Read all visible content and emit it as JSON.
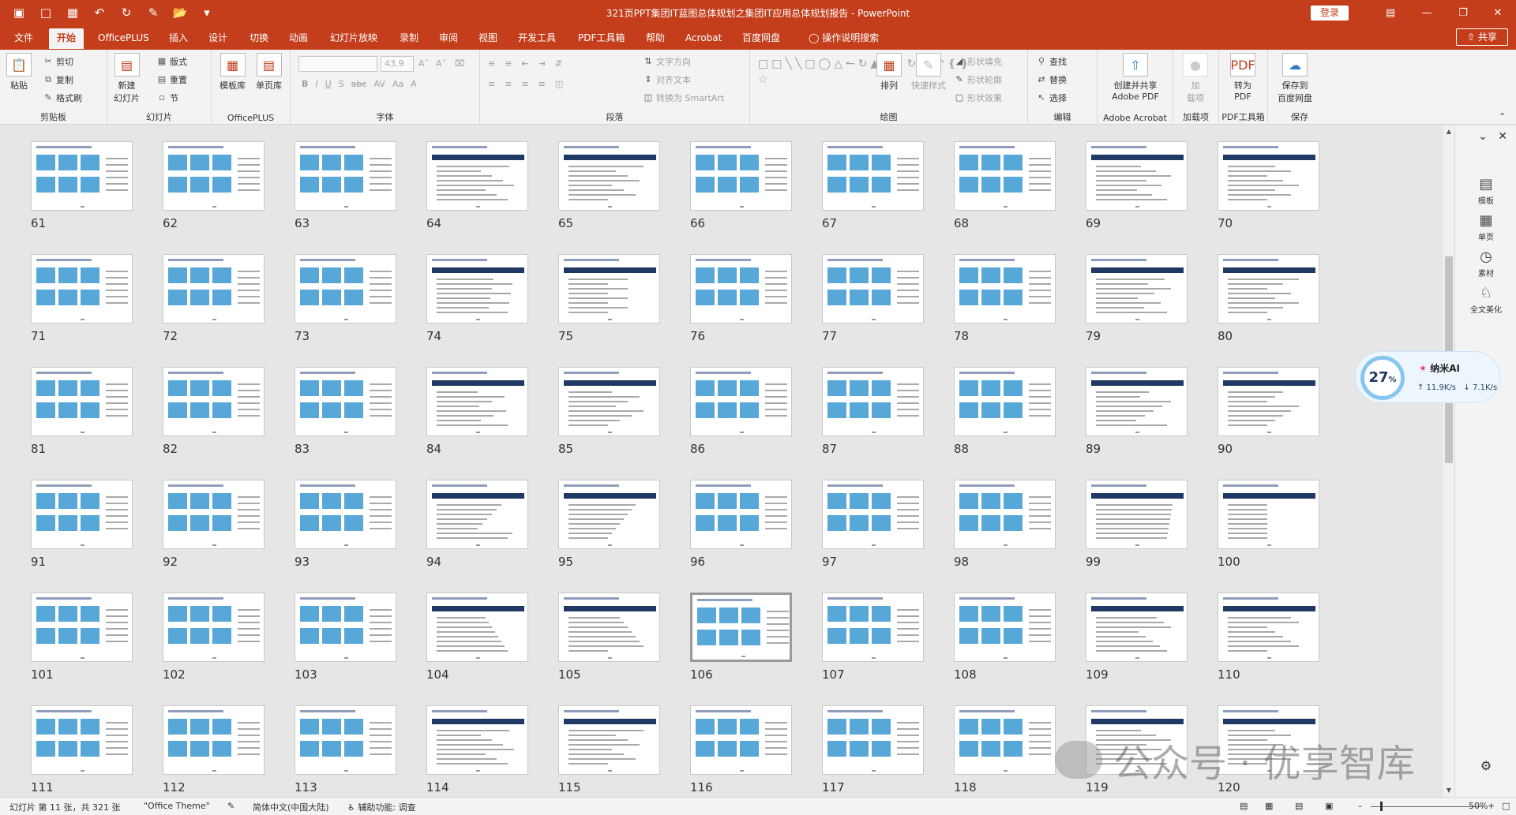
{
  "window": {
    "title": "321页PPT集团IT蓝图总体规划之集团IT应用总体规划报告  -  PowerPoint",
    "login": "登录",
    "quick_access": [
      "save-icon",
      "new-icon",
      "print-preview-icon",
      "undo-icon",
      "redo-icon",
      "format-icon",
      "open-icon",
      "customize-icon"
    ]
  },
  "tabs": [
    "文件",
    "开始",
    "OfficePLUS",
    "插入",
    "设计",
    "切换",
    "动画",
    "幻灯片放映",
    "录制",
    "审阅",
    "视图",
    "开发工具",
    "PDF工具箱",
    "帮助",
    "Acrobat",
    "百度网盘",
    "操作说明搜索"
  ],
  "active_tab": "开始",
  "share_label": "共享",
  "ribbon": {
    "clipboard": {
      "paste": "粘贴",
      "cut": "剪切",
      "copy": "复制",
      "format_painter": "格式刷",
      "label": "剪贴板"
    },
    "slides": {
      "new_slide": "新建\n幻灯片",
      "layout": "版式",
      "reset": "重置",
      "section": "节",
      "label": "幻灯片"
    },
    "officeplus": {
      "template": "模板库",
      "single": "单页库",
      "label": "OfficePLUS"
    },
    "font": {
      "font_size": "43.9",
      "label": "字体"
    },
    "paragraph": {
      "text_direction": "文字方向",
      "align_text": "对齐文本",
      "smartart": "转换为 SmartArt",
      "label": "段落"
    },
    "drawing": {
      "arrange": "排列",
      "quick_styles": "快速样式",
      "shape_fill": "形状填充",
      "shape_outline": "形状轮廓",
      "shape_effects": "形状效果",
      "label": "绘图"
    },
    "editing": {
      "find": "查找",
      "replace": "替换",
      "select": "选择",
      "label": "编辑"
    },
    "acrobat": {
      "create_share": "创建并共享\nAdobe PDF",
      "label": "Adobe Acrobat"
    },
    "addins": {
      "add": "加\n载项",
      "label": "加载项"
    },
    "pdf": {
      "convert": "转为\nPDF",
      "label": "PDF工具箱"
    },
    "save": {
      "save_baidu": "保存到\n百度网盘",
      "label": "保存"
    }
  },
  "slides": {
    "selected": 106,
    "rows": [
      [
        61,
        62,
        63,
        64,
        65,
        66,
        67,
        68,
        69,
        70
      ],
      [
        71,
        72,
        73,
        74,
        75,
        76,
        77,
        78,
        79,
        80
      ],
      [
        81,
        82,
        83,
        84,
        85,
        86,
        87,
        88,
        89,
        90
      ],
      [
        91,
        92,
        93,
        94,
        95,
        96,
        97,
        98,
        99,
        100
      ],
      [
        101,
        102,
        103,
        104,
        105,
        106,
        107,
        108,
        109,
        110
      ],
      [
        111,
        112,
        113,
        114,
        115,
        116,
        117,
        118,
        119,
        120
      ]
    ]
  },
  "side_panel": [
    "模板",
    "单页",
    "素材",
    "全文美化"
  ],
  "ai_widget": {
    "percent": "27",
    "percent_sign": "%",
    "name": "纳米AI",
    "up": "↑ 11.9K/s",
    "down": "↓ 7.1K/s"
  },
  "watermark": "公众号 · 优享智库",
  "status": {
    "slide_info": "幻灯片 第 11 张，共 321 张",
    "theme": "\"Office Theme\"",
    "language": "简体中文(中国大陆)",
    "accessibility": "辅助功能: 调查",
    "zoom": "50%"
  },
  "colors": {
    "accent": "#c43e1c",
    "slide_title_bar": "#1f3864",
    "diagram_blue": "#57a7d8"
  }
}
